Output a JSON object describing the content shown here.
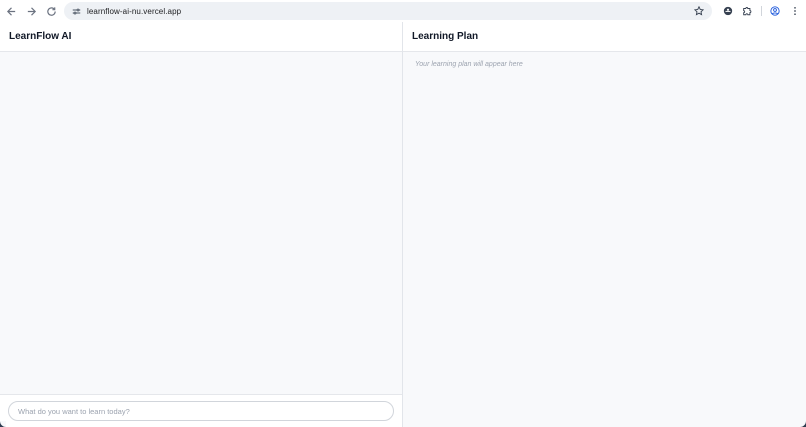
{
  "browser": {
    "url": "learnflow-ai-nu.vercel.app",
    "icons": [
      "back-arrow-icon",
      "forward-arrow-icon",
      "reload-icon",
      "site-settings-icon",
      "star-icon",
      "extension-icon",
      "puzzle-icon",
      "profile-icon",
      "more-menu-icon"
    ]
  },
  "chat_panel": {
    "title": "LearnFlow AI",
    "input_placeholder": "What do you want to learn today?"
  },
  "plan_panel": {
    "title": "Learning Plan",
    "placeholder": "Your learning plan will appear here"
  },
  "colors": {
    "accent": "#1a56db",
    "panel_background": "#f8f9fb",
    "header_background": "#ffffff",
    "muted_text": "#9ca3af"
  }
}
